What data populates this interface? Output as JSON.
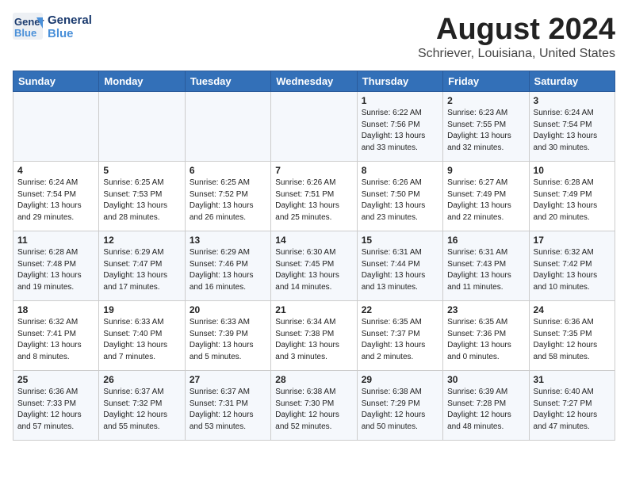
{
  "header": {
    "logo_line1": "General",
    "logo_line2": "Blue",
    "title": "August 2024",
    "subtitle": "Schriever, Louisiana, United States"
  },
  "days_of_week": [
    "Sunday",
    "Monday",
    "Tuesday",
    "Wednesday",
    "Thursday",
    "Friday",
    "Saturday"
  ],
  "weeks": [
    [
      {
        "day": "",
        "info": ""
      },
      {
        "day": "",
        "info": ""
      },
      {
        "day": "",
        "info": ""
      },
      {
        "day": "",
        "info": ""
      },
      {
        "day": "1",
        "info": "Sunrise: 6:22 AM\nSunset: 7:56 PM\nDaylight: 13 hours\nand 33 minutes."
      },
      {
        "day": "2",
        "info": "Sunrise: 6:23 AM\nSunset: 7:55 PM\nDaylight: 13 hours\nand 32 minutes."
      },
      {
        "day": "3",
        "info": "Sunrise: 6:24 AM\nSunset: 7:54 PM\nDaylight: 13 hours\nand 30 minutes."
      }
    ],
    [
      {
        "day": "4",
        "info": "Sunrise: 6:24 AM\nSunset: 7:54 PM\nDaylight: 13 hours\nand 29 minutes."
      },
      {
        "day": "5",
        "info": "Sunrise: 6:25 AM\nSunset: 7:53 PM\nDaylight: 13 hours\nand 28 minutes."
      },
      {
        "day": "6",
        "info": "Sunrise: 6:25 AM\nSunset: 7:52 PM\nDaylight: 13 hours\nand 26 minutes."
      },
      {
        "day": "7",
        "info": "Sunrise: 6:26 AM\nSunset: 7:51 PM\nDaylight: 13 hours\nand 25 minutes."
      },
      {
        "day": "8",
        "info": "Sunrise: 6:26 AM\nSunset: 7:50 PM\nDaylight: 13 hours\nand 23 minutes."
      },
      {
        "day": "9",
        "info": "Sunrise: 6:27 AM\nSunset: 7:49 PM\nDaylight: 13 hours\nand 22 minutes."
      },
      {
        "day": "10",
        "info": "Sunrise: 6:28 AM\nSunset: 7:49 PM\nDaylight: 13 hours\nand 20 minutes."
      }
    ],
    [
      {
        "day": "11",
        "info": "Sunrise: 6:28 AM\nSunset: 7:48 PM\nDaylight: 13 hours\nand 19 minutes."
      },
      {
        "day": "12",
        "info": "Sunrise: 6:29 AM\nSunset: 7:47 PM\nDaylight: 13 hours\nand 17 minutes."
      },
      {
        "day": "13",
        "info": "Sunrise: 6:29 AM\nSunset: 7:46 PM\nDaylight: 13 hours\nand 16 minutes."
      },
      {
        "day": "14",
        "info": "Sunrise: 6:30 AM\nSunset: 7:45 PM\nDaylight: 13 hours\nand 14 minutes."
      },
      {
        "day": "15",
        "info": "Sunrise: 6:31 AM\nSunset: 7:44 PM\nDaylight: 13 hours\nand 13 minutes."
      },
      {
        "day": "16",
        "info": "Sunrise: 6:31 AM\nSunset: 7:43 PM\nDaylight: 13 hours\nand 11 minutes."
      },
      {
        "day": "17",
        "info": "Sunrise: 6:32 AM\nSunset: 7:42 PM\nDaylight: 13 hours\nand 10 minutes."
      }
    ],
    [
      {
        "day": "18",
        "info": "Sunrise: 6:32 AM\nSunset: 7:41 PM\nDaylight: 13 hours\nand 8 minutes."
      },
      {
        "day": "19",
        "info": "Sunrise: 6:33 AM\nSunset: 7:40 PM\nDaylight: 13 hours\nand 7 minutes."
      },
      {
        "day": "20",
        "info": "Sunrise: 6:33 AM\nSunset: 7:39 PM\nDaylight: 13 hours\nand 5 minutes."
      },
      {
        "day": "21",
        "info": "Sunrise: 6:34 AM\nSunset: 7:38 PM\nDaylight: 13 hours\nand 3 minutes."
      },
      {
        "day": "22",
        "info": "Sunrise: 6:35 AM\nSunset: 7:37 PM\nDaylight: 13 hours\nand 2 minutes."
      },
      {
        "day": "23",
        "info": "Sunrise: 6:35 AM\nSunset: 7:36 PM\nDaylight: 13 hours\nand 0 minutes."
      },
      {
        "day": "24",
        "info": "Sunrise: 6:36 AM\nSunset: 7:35 PM\nDaylight: 12 hours\nand 58 minutes."
      }
    ],
    [
      {
        "day": "25",
        "info": "Sunrise: 6:36 AM\nSunset: 7:33 PM\nDaylight: 12 hours\nand 57 minutes."
      },
      {
        "day": "26",
        "info": "Sunrise: 6:37 AM\nSunset: 7:32 PM\nDaylight: 12 hours\nand 55 minutes."
      },
      {
        "day": "27",
        "info": "Sunrise: 6:37 AM\nSunset: 7:31 PM\nDaylight: 12 hours\nand 53 minutes."
      },
      {
        "day": "28",
        "info": "Sunrise: 6:38 AM\nSunset: 7:30 PM\nDaylight: 12 hours\nand 52 minutes."
      },
      {
        "day": "29",
        "info": "Sunrise: 6:38 AM\nSunset: 7:29 PM\nDaylight: 12 hours\nand 50 minutes."
      },
      {
        "day": "30",
        "info": "Sunrise: 6:39 AM\nSunset: 7:28 PM\nDaylight: 12 hours\nand 48 minutes."
      },
      {
        "day": "31",
        "info": "Sunrise: 6:40 AM\nSunset: 7:27 PM\nDaylight: 12 hours\nand 47 minutes."
      }
    ]
  ]
}
